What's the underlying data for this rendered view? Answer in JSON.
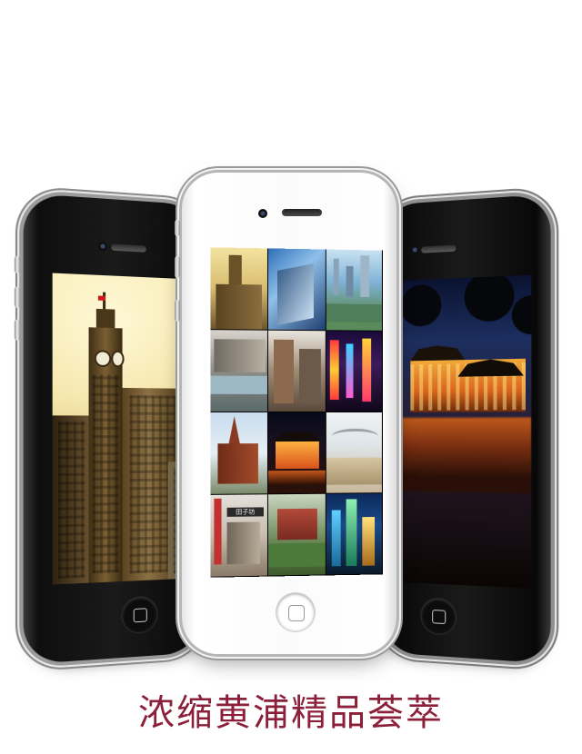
{
  "caption": {
    "text": "浓缩黄浦精品荟萃"
  },
  "colors": {
    "caption": "#8c1f3a",
    "background": "#ffffff"
  },
  "phones": [
    {
      "id": "left",
      "finish": "black",
      "screen_subject": "sepia-photo-clock-tower-building"
    },
    {
      "id": "center",
      "finish": "white",
      "screen_subject": "photo-grid-3x4"
    },
    {
      "id": "right",
      "finish": "black",
      "screen_subject": "night-photo-lit-pavilion-reflection"
    }
  ],
  "photo_grid": {
    "columns": 3,
    "rows": 4,
    "tiles": [
      "clock-tower-building",
      "modern-glass-building",
      "city-skyline-aerial",
      "street-with-fountain",
      "old-street-buildings",
      "neon-shopping-street",
      "church-spire",
      "lit-pavilion-night",
      "riverside-promenade",
      "old-lane-gate",
      "garden-villa",
      "skyscrapers-night"
    ],
    "gate_sign_text": "田子坊"
  }
}
